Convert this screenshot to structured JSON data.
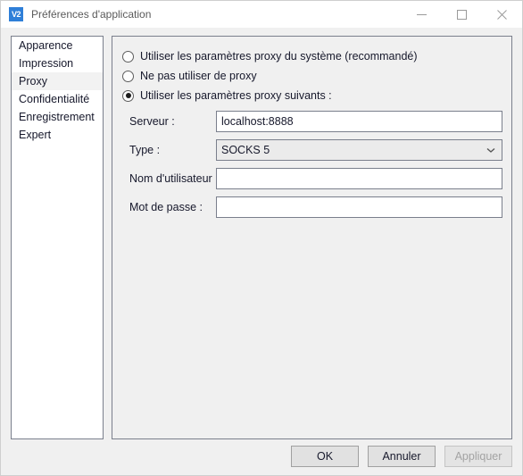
{
  "window": {
    "title": "Préférences d'application",
    "icon_label": "V2",
    "icon_name": "app-icon-v2",
    "controls": [
      {
        "name": "minimize-icon",
        "label": "Réduire"
      },
      {
        "name": "maximize-icon",
        "label": "Agrandir"
      },
      {
        "name": "close-icon",
        "label": "Fermer"
      }
    ]
  },
  "sidebar": {
    "items": [
      {
        "label": "Apparence",
        "key": "apparence",
        "selected": false
      },
      {
        "label": "Impression",
        "key": "impression",
        "selected": false
      },
      {
        "label": "Proxy",
        "key": "proxy",
        "selected": true
      },
      {
        "label": "Confidentialité",
        "key": "confidentialite",
        "selected": false
      },
      {
        "label": "Enregistrement",
        "key": "enregistrement",
        "selected": false
      },
      {
        "label": "Expert",
        "key": "expert",
        "selected": false
      }
    ]
  },
  "proxy_panel": {
    "radios": [
      {
        "label": "Utiliser les paramètres proxy du système (recommandé)",
        "key": "system",
        "checked": false
      },
      {
        "label": "Ne pas utiliser de proxy",
        "key": "none",
        "checked": false
      },
      {
        "label": "Utiliser les paramètres proxy suivants :",
        "key": "manual",
        "checked": true
      }
    ],
    "fields": {
      "server": {
        "label": "Serveur :",
        "value": "localhost:8888",
        "placeholder": ""
      },
      "type": {
        "label": "Type :",
        "value": "SOCKS 5",
        "options": [
          "SOCKS 5"
        ]
      },
      "username": {
        "label": "Nom d'utilisateur :",
        "value": "",
        "placeholder": ""
      },
      "password": {
        "label": "Mot de passe :",
        "value": "",
        "placeholder": ""
      }
    }
  },
  "footer": {
    "ok_label": "OK",
    "cancel_label": "Annuler",
    "apply_label": "Appliquer",
    "apply_enabled": false
  },
  "colors": {
    "accent": "#2f7fd8",
    "window_background": "#f0f0f0",
    "titlebar_background": "#ffffff",
    "panel_border": "#7a7f8c",
    "selection": "#f2f2f2"
  }
}
